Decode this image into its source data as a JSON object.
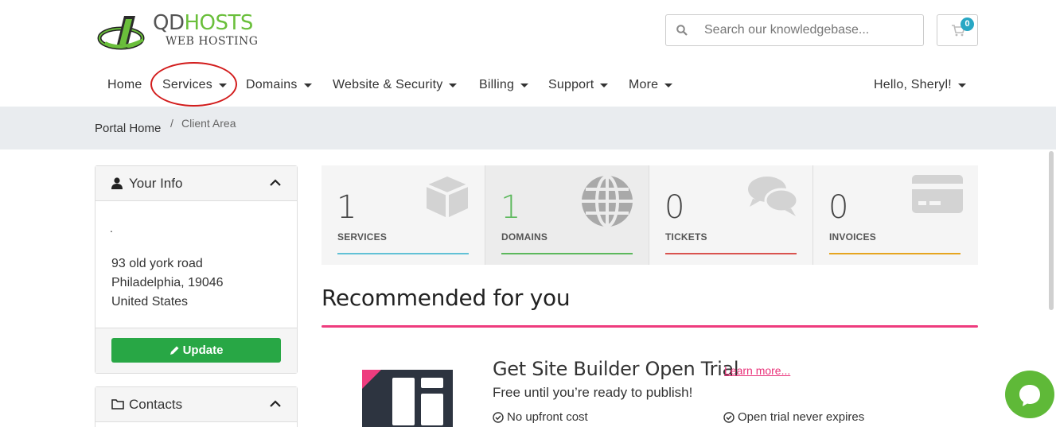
{
  "brand": {
    "logo_text_a": "QD",
    "logo_text_b": "HOSTS",
    "logo_subtitle": "WEB HOSTING",
    "accent": "#6abf3b"
  },
  "search": {
    "placeholder": "Search our knowledgebase...",
    "icon": "search-icon"
  },
  "cart": {
    "count": "0",
    "icon": "cart-icon"
  },
  "nav": {
    "items": [
      {
        "label": "Home"
      },
      {
        "label": "Services"
      },
      {
        "label": "Domains"
      },
      {
        "label": "Website & Security"
      },
      {
        "label": "Billing"
      },
      {
        "label": "Support"
      },
      {
        "label": "More"
      }
    ],
    "user": "Hello, Sheryl!"
  },
  "breadcrumb": {
    "home": "Portal Home",
    "separator": "/",
    "current": "Client Area"
  },
  "your_info": {
    "title": "Your Info",
    "dot": ".",
    "address_lines": [
      "93 old york road",
      "Philadelphia, 19046",
      "United States"
    ],
    "update_label": "Update"
  },
  "contacts": {
    "title": "Contacts"
  },
  "stats": [
    {
      "count": "1",
      "label": "SERVICES",
      "color": "#61c1d6"
    },
    {
      "count": "1",
      "label": "DOMAINS",
      "color": "#5cb85c"
    },
    {
      "count": "0",
      "label": "TICKETS",
      "color": "#d9534f"
    },
    {
      "count": "0",
      "label": "INVOICES",
      "color": "#e6a520"
    }
  ],
  "recommended": {
    "title": "Recommended for you",
    "accent": "#ee3c7e",
    "promo_title": "Get Site Builder Open Trial",
    "learn_more": "Learn more...",
    "subtitle": "Free until you’re ready to publish!",
    "features": [
      "No upfront cost",
      "Open trial never expires"
    ]
  }
}
